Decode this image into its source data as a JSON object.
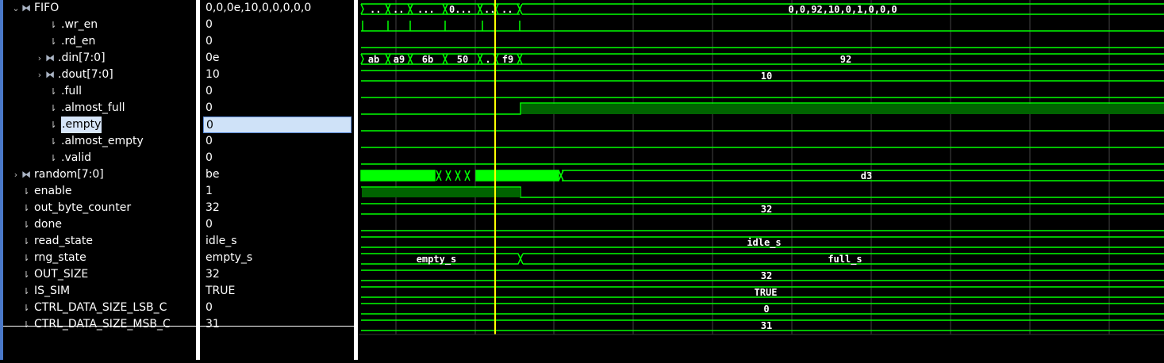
{
  "signals": [
    {
      "name": "FIFO",
      "value": "0,0,0e,10,0,0,0,0,0",
      "indent": 0,
      "expander": "open",
      "icon": "bus"
    },
    {
      "name": ".wr_en",
      "value": "0",
      "indent": 2,
      "icon": "bit"
    },
    {
      "name": ".rd_en",
      "value": "0",
      "indent": 2,
      "icon": "bit"
    },
    {
      "name": ".din[7:0]",
      "value": "0e",
      "indent": 1,
      "expander": "closed",
      "icon": "bus"
    },
    {
      "name": ".dout[7:0]",
      "value": "10",
      "indent": 1,
      "expander": "closed",
      "icon": "bus"
    },
    {
      "name": ".full",
      "value": "0",
      "indent": 2,
      "icon": "bit"
    },
    {
      "name": ".almost_full",
      "value": "0",
      "indent": 2,
      "icon": "bit"
    },
    {
      "name": ".empty",
      "value": "0",
      "indent": 2,
      "icon": "bit",
      "selected": true
    },
    {
      "name": ".almost_empty",
      "value": "0",
      "indent": 2,
      "icon": "bit"
    },
    {
      "name": ".valid",
      "value": "0",
      "indent": 2,
      "icon": "bit"
    },
    {
      "name": "random[7:0]",
      "value": "be",
      "indent": 0,
      "expander": "closed",
      "icon": "bus"
    },
    {
      "name": "enable",
      "value": "1",
      "indent": 0,
      "icon": "bit"
    },
    {
      "name": "out_byte_counter",
      "value": "32",
      "indent": 0,
      "icon": "bit"
    },
    {
      "name": "done",
      "value": "0",
      "indent": 0,
      "icon": "bit"
    },
    {
      "name": "read_state",
      "value": "idle_s",
      "indent": 0,
      "icon": "bit"
    },
    {
      "name": "rng_state",
      "value": "empty_s",
      "indent": 0,
      "icon": "bit"
    },
    {
      "name": "OUT_SIZE",
      "value": "32",
      "indent": 0,
      "icon": "bit"
    },
    {
      "name": "IS_SIM",
      "value": "TRUE",
      "indent": 0,
      "icon": "bit"
    },
    {
      "name": "CTRL_DATA_SIZE_LSB_C",
      "value": "0",
      "indent": 0,
      "icon": "bit"
    },
    {
      "name": "CTRL_DATA_SIZE_MSB_C",
      "value": "31",
      "indent": 0,
      "icon": "bit"
    }
  ],
  "icons": {
    "bit": "bit-signal-icon",
    "bus": "bus-signal-icon",
    "expander_open": "chevron-down-icon",
    "expander_closed": "chevron-right-icon"
  },
  "waveform": {
    "colors": {
      "wave": "#00ff00",
      "dim": "#006400",
      "cursor": "#ffff00",
      "grid": "#444444"
    },
    "bus_labels": {
      "fifo": [
        "..",
        "..",
        "...",
        "0...",
        "..",
        "..",
        "0,0,92,10,0,1,0,0,0"
      ],
      "din": [
        "ab",
        "a9",
        "6b",
        "50",
        ".",
        "f9",
        "92"
      ],
      "dout": [
        "10"
      ],
      "random": [
        "d3"
      ],
      "out_byte_counter": [
        "32"
      ],
      "read_state": [
        "idle_s"
      ],
      "rng_state": [
        "empty_s",
        "full_s"
      ],
      "out_size": [
        "32"
      ],
      "is_sim": [
        "TRUE"
      ],
      "lsb": [
        "0"
      ],
      "msb": [
        "31"
      ]
    }
  }
}
